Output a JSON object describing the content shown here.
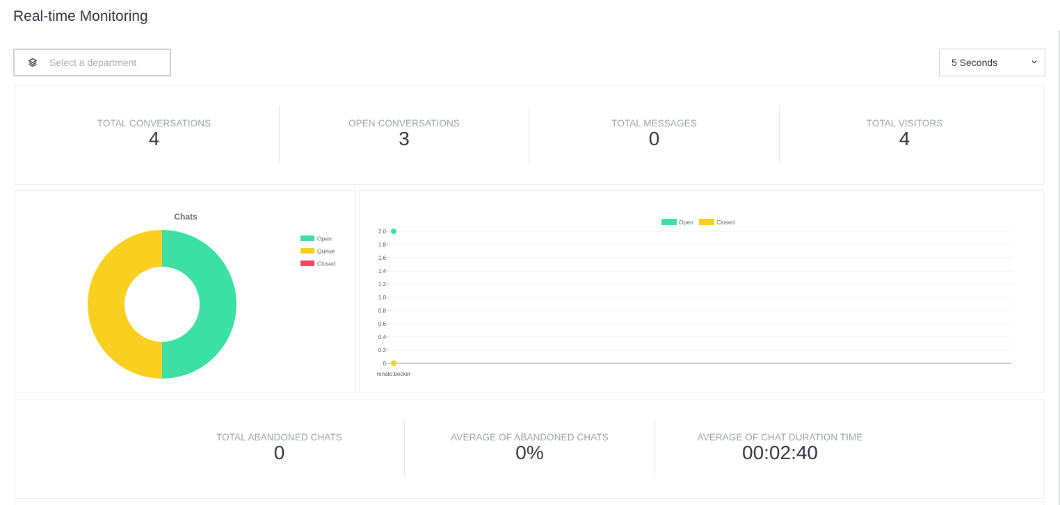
{
  "page": {
    "title": "Real-time Monitoring"
  },
  "filters": {
    "department_placeholder": "Select a department",
    "interval_value": "5 Seconds"
  },
  "stats_top": [
    {
      "label": "TOTAL CONVERSATIONS",
      "value": "4"
    },
    {
      "label": "OPEN CONVERSATIONS",
      "value": "3"
    },
    {
      "label": "TOTAL MESSAGES",
      "value": "0"
    },
    {
      "label": "TOTAL VISITORS",
      "value": "4"
    }
  ],
  "stats_bottom": [
    {
      "label": "TOTAL ABANDONED CHATS",
      "value": "0"
    },
    {
      "label": "AVERAGE OF ABANDONED CHATS",
      "value": "0%"
    },
    {
      "label": "AVERAGE OF CHAT DURATION TIME",
      "value": "00:02:40"
    }
  ],
  "colors": {
    "open": "#3ce0a4",
    "queue": "#f9d020",
    "closed": "#f5455c",
    "text": "#2f343d",
    "muted": "#9ea2a8"
  },
  "chart_data": [
    {
      "type": "pie",
      "title": "Chats",
      "categories": [
        "Open",
        "Queue",
        "Closed"
      ],
      "values": [
        1,
        1,
        0
      ]
    },
    {
      "type": "line",
      "title": "",
      "categories": [
        "renato.becker"
      ],
      "series": [
        {
          "name": "Open",
          "values": [
            2
          ]
        },
        {
          "name": "Closed",
          "values": [
            0
          ]
        }
      ],
      "ylim": [
        0,
        2
      ],
      "yticks": [
        "2.0",
        "1.8",
        "1.6",
        "1.4",
        "1.2",
        "1.0",
        "0.8",
        "0.6",
        "0.4",
        "0.2",
        "0"
      ],
      "legend": "top"
    }
  ]
}
